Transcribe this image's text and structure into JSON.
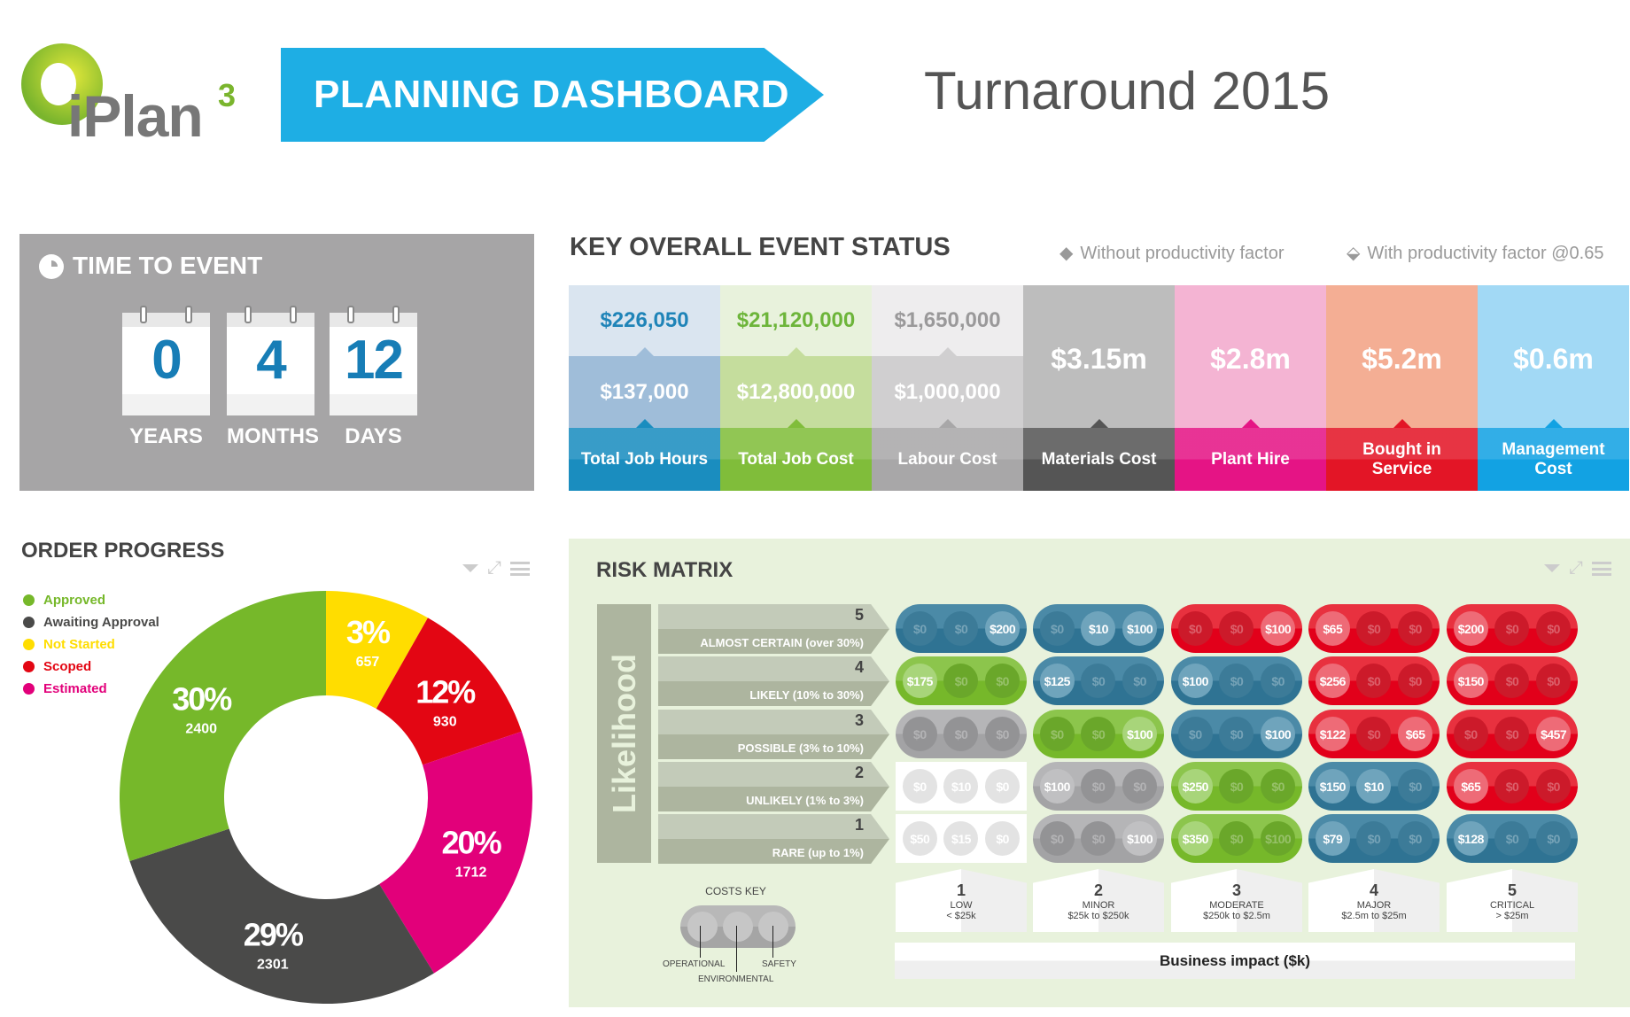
{
  "header": {
    "logo_text": "iPlan",
    "logo_sup": "3",
    "banner": "PLANNING DASHBOARD",
    "event_title": "Turnaround 2015",
    "accent": "#1eaee4"
  },
  "time_to_event": {
    "title": "TIME TO EVENT",
    "icon": "clock-icon",
    "units": [
      {
        "value": "0",
        "label": "YEARS"
      },
      {
        "value": "4",
        "label": "MONTHS"
      },
      {
        "value": "12",
        "label": "DAYS"
      }
    ]
  },
  "key_status": {
    "title": "KEY OVERALL EVENT STATUS",
    "legend": [
      {
        "icon": "diamond-icon",
        "label": "Without productivity factor"
      },
      {
        "icon": "double-diamond-icon",
        "label": "With productivity factor @0.65"
      }
    ],
    "cards": [
      {
        "label": "Total Job Hours",
        "without": "$226,050",
        "with": "$137,000",
        "colors": {
          "top": "#dae5f0",
          "topText": "#1f84b8",
          "mid": "#9fbdd9",
          "bottom": "#1a8dbf"
        }
      },
      {
        "label": "Total Job Cost",
        "without": "$21,120,000",
        "with": "$12,800,000",
        "colors": {
          "top": "#e8f2dc",
          "topText": "#6db53a",
          "mid": "#c5dd9d",
          "bottom": "#80bd3a"
        }
      },
      {
        "label": "Labour Cost",
        "without": "$1,650,000",
        "with": "$1,000,000",
        "colors": {
          "top": "#eeedee",
          "topText": "#9a999a",
          "mid": "#d0cfd0",
          "bottom": "#a8a7a8"
        }
      },
      {
        "label": "Materials Cost",
        "value": "$3.15m",
        "colors": {
          "top": "#bdbdbd",
          "bottom": "#555555"
        }
      },
      {
        "label": "Plant Hire",
        "value": "$2.8m",
        "colors": {
          "top": "#f4b4d3",
          "bottom": "#e51485"
        }
      },
      {
        "label": "Bought in Service",
        "value": "$5.2m",
        "colors": {
          "top": "#f4ae94",
          "bottom": "#e31526"
        }
      },
      {
        "label": "Management Cost",
        "value": "$0.6m",
        "colors": {
          "top": "#a2d9f5",
          "bottom": "#12a2e3"
        }
      }
    ]
  },
  "order_progress": {
    "title": "ORDER PROGRESS",
    "widget_icons": [
      "dropdown-icon",
      "expand-icon",
      "menu-icon"
    ],
    "chart_data": {
      "type": "pie",
      "donut": true,
      "legend_position": "top-left",
      "slices": [
        {
          "name": "Not Started",
          "percent": "3%",
          "count": 657,
          "color": "#ffdd00"
        },
        {
          "name": "Scoped",
          "percent": "12%",
          "count": 930,
          "color": "#e30613"
        },
        {
          "name": "Estimated",
          "percent": "20%",
          "count": 1712,
          "color": "#e2007a"
        },
        {
          "name": "Awaiting Approval",
          "percent": "29%",
          "count": 2301,
          "color": "#4a4a49"
        },
        {
          "name": "Approved",
          "percent": "30%",
          "count": 2400,
          "color": "#76b82a"
        }
      ],
      "legend_order": [
        "Approved",
        "Awaiting Approval",
        "Not Started",
        "Scoped",
        "Estimated"
      ]
    }
  },
  "risk_matrix": {
    "title": "RISK MATRIX",
    "likelihood_label": "Likelihood",
    "likelihood": [
      {
        "n": "5",
        "label": "ALMOST CERTAIN (over 30%)"
      },
      {
        "n": "4",
        "label": "LIKELY (10% to 30%)"
      },
      {
        "n": "3",
        "label": "POSSIBLE (3% to 10%)"
      },
      {
        "n": "2",
        "label": "UNLIKELY (1% to 3%)"
      },
      {
        "n": "1",
        "label": "RARE (up to 1%)"
      }
    ],
    "impact": [
      {
        "n": "1",
        "label": "LOW",
        "range": "< $25k"
      },
      {
        "n": "2",
        "label": "MINOR",
        "range": "$25k to $250k"
      },
      {
        "n": "3",
        "label": "MODERATE",
        "range": "$250k to $2.5m"
      },
      {
        "n": "4",
        "label": "MAJOR",
        "range": "$2.5m to $25m"
      },
      {
        "n": "5",
        "label": "CRITICAL",
        "range": "> $25m"
      }
    ],
    "impact_axis": "Business impact ($k)",
    "palette": {
      "blue": "#2f7393",
      "red": "#e2001a",
      "green": "#76b82a",
      "grey": "#a3a3a5",
      "white": "#ffffff"
    },
    "cells": [
      [
        {
          "c": "blue",
          "v": [
            "$0",
            "$0",
            "$200"
          ],
          "lit": [
            0,
            0,
            1
          ]
        },
        {
          "c": "blue",
          "v": [
            "$0",
            "$10",
            "$100"
          ],
          "lit": [
            0,
            1,
            1
          ]
        },
        {
          "c": "red",
          "v": [
            "$0",
            "$0",
            "$100"
          ],
          "lit": [
            0,
            0,
            1
          ]
        },
        {
          "c": "red",
          "v": [
            "$65",
            "$0",
            "$0"
          ],
          "lit": [
            1,
            0,
            0
          ]
        },
        {
          "c": "red",
          "v": [
            "$200",
            "$0",
            "$0"
          ],
          "lit": [
            1,
            0,
            0
          ]
        }
      ],
      [
        {
          "c": "green",
          "v": [
            "$175",
            "$0",
            "$0"
          ],
          "lit": [
            1,
            0,
            0
          ]
        },
        {
          "c": "blue",
          "v": [
            "$125",
            "$0",
            "$0"
          ],
          "lit": [
            1,
            0,
            0
          ]
        },
        {
          "c": "blue",
          "v": [
            "$100",
            "$0",
            "$0"
          ],
          "lit": [
            1,
            0,
            0
          ]
        },
        {
          "c": "red",
          "v": [
            "$256",
            "$0",
            "$0"
          ],
          "lit": [
            1,
            0,
            0
          ]
        },
        {
          "c": "red",
          "v": [
            "$150",
            "$0",
            "$0"
          ],
          "lit": [
            1,
            0,
            0
          ]
        }
      ],
      [
        {
          "c": "grey",
          "v": [
            "$0",
            "$0",
            "$0"
          ],
          "lit": [
            0,
            0,
            0
          ]
        },
        {
          "c": "green",
          "v": [
            "$0",
            "$0",
            "$100"
          ],
          "lit": [
            0,
            0,
            1
          ]
        },
        {
          "c": "blue",
          "v": [
            "$0",
            "$0",
            "$100"
          ],
          "lit": [
            0,
            0,
            1
          ]
        },
        {
          "c": "red",
          "v": [
            "$122",
            "$0",
            "$65"
          ],
          "lit": [
            1,
            0,
            1
          ]
        },
        {
          "c": "red",
          "v": [
            "$0",
            "$0",
            "$457"
          ],
          "lit": [
            0,
            0,
            1
          ]
        }
      ],
      [
        {
          "c": "white",
          "v": [
            "$0",
            "$10",
            "$0"
          ],
          "lit": [
            0,
            0,
            0
          ]
        },
        {
          "c": "grey",
          "v": [
            "$100",
            "$0",
            "$0"
          ],
          "lit": [
            1,
            0,
            0
          ]
        },
        {
          "c": "green",
          "v": [
            "$250",
            "$0",
            "$0"
          ],
          "lit": [
            1,
            0,
            0
          ]
        },
        {
          "c": "blue",
          "v": [
            "$150",
            "$10",
            "$0"
          ],
          "lit": [
            1,
            1,
            0
          ]
        },
        {
          "c": "red",
          "v": [
            "$65",
            "$0",
            "$0"
          ],
          "lit": [
            1,
            0,
            0
          ]
        }
      ],
      [
        {
          "c": "white",
          "v": [
            "$50",
            "$15",
            "$0"
          ],
          "lit": [
            0,
            0,
            0
          ]
        },
        {
          "c": "grey",
          "v": [
            "$0",
            "$0",
            "$100"
          ],
          "lit": [
            0,
            0,
            1
          ]
        },
        {
          "c": "green",
          "v": [
            "$350",
            "$0",
            "$100"
          ],
          "lit": [
            1,
            0,
            0
          ]
        },
        {
          "c": "blue",
          "v": [
            "$79",
            "$0",
            "$0"
          ],
          "lit": [
            1,
            0,
            0
          ]
        },
        {
          "c": "blue",
          "v": [
            "$128",
            "$0",
            "$0"
          ],
          "lit": [
            1,
            0,
            0
          ]
        }
      ]
    ],
    "costs_key": {
      "title": "COSTS KEY",
      "labels": [
        "OPERATIONAL",
        "ENVIRONMENTAL",
        "SAFETY"
      ]
    }
  }
}
